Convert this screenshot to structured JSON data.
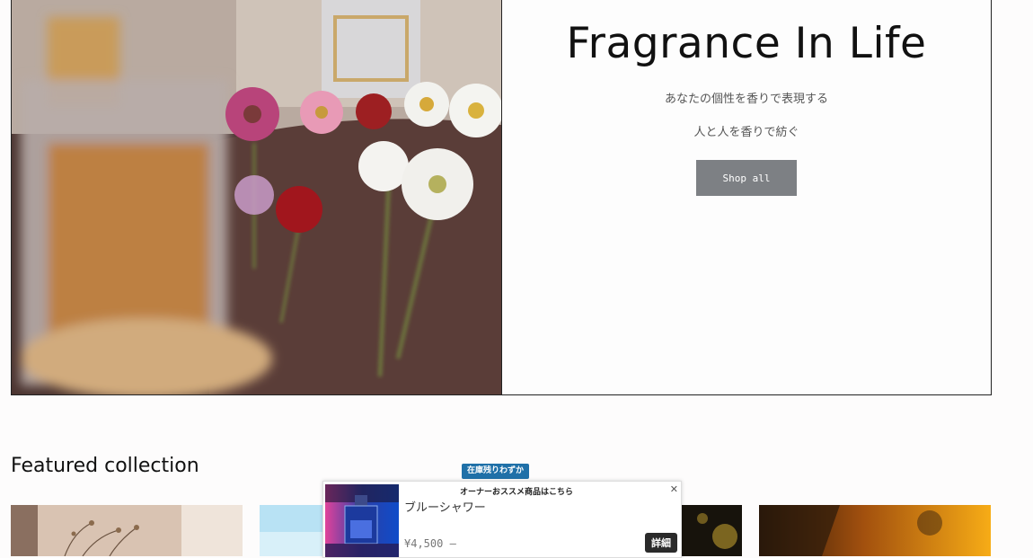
{
  "hero": {
    "title": "Fragrance In Life",
    "line1": "あなたの個性を香りで表現する",
    "line2": "人と人を香りで紡ぐ",
    "button_label": "Shop all",
    "image": "perfume-bottles-and-flowers"
  },
  "featured": {
    "title": "Featured collection",
    "cards": [
      {
        "image": "dried-flowers-photo"
      },
      {
        "image": "blue-sky-photo"
      },
      {
        "image": "dark-gold-photo"
      },
      {
        "image": "orange-sunset-photo"
      }
    ]
  },
  "popup": {
    "badge": "在庫残りわずか",
    "header": "オーナーおススメ商品はこちら",
    "close_icon": "close-icon",
    "product_name": "ブルーシャワー",
    "price": "¥4,500 –",
    "detail_label": "詳細",
    "thumbnail": "blue-perfume-bottle"
  },
  "colors": {
    "button_bg": "#7d8084",
    "badge_bg": "#1f70a8",
    "detail_bg": "#2a2a2a"
  }
}
